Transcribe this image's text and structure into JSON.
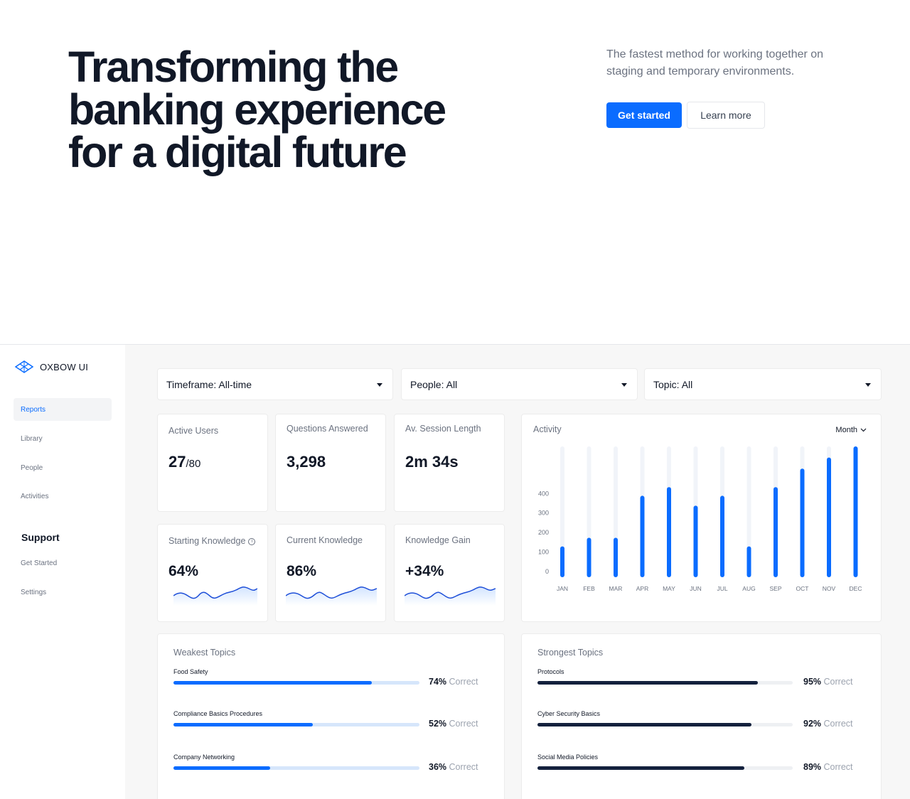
{
  "hero": {
    "title": "Transforming the banking experience for a digital future",
    "subtitle": "The fastest method for working together on staging and temporary environments.",
    "primary_cta": "Get started",
    "secondary_cta": "Learn more"
  },
  "brand": {
    "name": "OXBOW UI",
    "accent": "#0a6cff",
    "dark": "#111827"
  },
  "sidebar": {
    "items": [
      {
        "label": "Reports",
        "active": true
      },
      {
        "label": "Library",
        "active": false
      },
      {
        "label": "People",
        "active": false
      },
      {
        "label": "Activities",
        "active": false
      }
    ],
    "support_heading": "Support",
    "support_items": [
      {
        "label": "Get Started"
      },
      {
        "label": "Settings"
      }
    ]
  },
  "filters": [
    {
      "label": "Timeframe: All-time"
    },
    {
      "label": "People: All"
    },
    {
      "label": "Topic: All"
    }
  ],
  "stats": [
    {
      "label": "Active Users",
      "value": "27",
      "suffix": "/80"
    },
    {
      "label": "Questions Answered",
      "value": "3,298"
    },
    {
      "label": "Av. Session Length",
      "value": "2m 34s"
    }
  ],
  "knowledge": [
    {
      "label": "Starting Knowledge",
      "value": "64%",
      "info_icon": "info-icon"
    },
    {
      "label": "Current Knowledge",
      "value": "86%"
    },
    {
      "label": "Knowledge Gain",
      "value": "+34%"
    }
  ],
  "activity": {
    "title": "Activity",
    "period": "Month"
  },
  "chart_data": {
    "type": "bar",
    "categories": [
      "JAN",
      "FEB",
      "MAR",
      "APR",
      "MAY",
      "JUN",
      "JUL",
      "AUG",
      "SEP",
      "OCT",
      "NOV",
      "DEC"
    ],
    "values": [
      125,
      160,
      160,
      330,
      365,
      290,
      330,
      125,
      365,
      440,
      485,
      530
    ],
    "ylim": [
      0,
      530
    ],
    "yticks": [
      0,
      100,
      200,
      300,
      400
    ],
    "grid": false,
    "bar_color": "#0a6cff",
    "track_color": "#f1f4f9"
  },
  "weakest": {
    "title": "Weakest Topics",
    "items": [
      {
        "name": "Food Safety",
        "percent": 74,
        "pct_label": "74%",
        "suffix": "Correct"
      },
      {
        "name": "Compliance Basics Procedures",
        "percent": 52,
        "pct_label": "52%",
        "suffix": "Correct"
      },
      {
        "name": "Company Networking",
        "percent": 36,
        "pct_label": "36%",
        "suffix": "Correct"
      }
    ]
  },
  "strongest": {
    "title": "Strongest Topics",
    "items": [
      {
        "name": "Protocols",
        "percent": 95,
        "pct_label": "95%",
        "suffix": "Correct"
      },
      {
        "name": "Cyber Security Basics",
        "percent": 92,
        "pct_label": "92%",
        "suffix": "Correct"
      },
      {
        "name": "Social Media Policies",
        "percent": 89,
        "pct_label": "89%",
        "suffix": "Correct"
      }
    ]
  }
}
